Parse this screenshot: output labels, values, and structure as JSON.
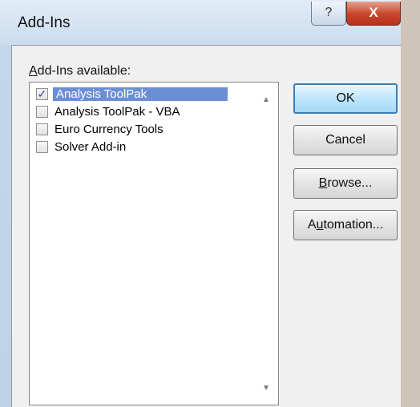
{
  "window": {
    "title": "Add-Ins"
  },
  "titlebar_buttons": {
    "help": "?",
    "close": "X"
  },
  "list": {
    "label_prefix": "A",
    "label_rest": "dd-Ins available:",
    "items": [
      {
        "label": "Analysis ToolPak",
        "checked": true,
        "selected": true
      },
      {
        "label": "Analysis ToolPak - VBA",
        "checked": false,
        "selected": false
      },
      {
        "label": "Euro Currency Tools",
        "checked": false,
        "selected": false
      },
      {
        "label": "Solver Add-in",
        "checked": false,
        "selected": false
      }
    ]
  },
  "buttons": {
    "ok": "OK",
    "cancel": "Cancel",
    "browse_prefix": "B",
    "browse_rest": "rowse...",
    "automation_prefix": "A",
    "automation_mnemonic": "u",
    "automation_rest": "tomation..."
  },
  "icons": {
    "check": "check-icon",
    "scroll_up": "scroll-up-icon",
    "scroll_down": "scroll-down-icon"
  }
}
